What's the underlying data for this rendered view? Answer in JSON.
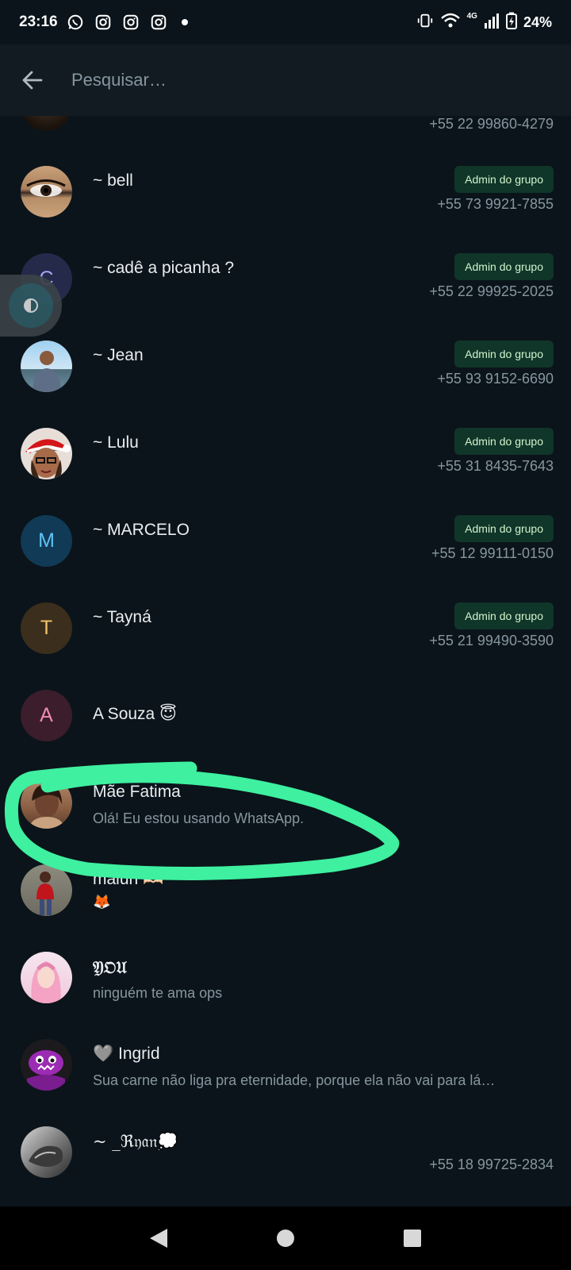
{
  "status_bar": {
    "time": "23:16",
    "network": "4G",
    "battery": "24%",
    "icons": [
      "whatsapp-icon",
      "instagram-icon",
      "instagram-icon",
      "instagram-icon",
      "notification-dot-icon",
      "vibrate-icon",
      "wifi-icon",
      "signal-icon",
      "battery-icon"
    ]
  },
  "search": {
    "placeholder": "Pesquisar…"
  },
  "colors": {
    "background": "#0b141a",
    "header": "#111b21",
    "badge_bg": "#103529",
    "badge_text": "#d1f4cc",
    "secondary_text": "#8696a0",
    "annotation": "#3ef0a0"
  },
  "participants": [
    {
      "name": "",
      "phone": "+55 22 99860-4279",
      "avatar": "photo"
    },
    {
      "name": "~ bell",
      "badge": "Admin do grupo",
      "phone": "+55 73 9921-7855",
      "avatar": "photo"
    },
    {
      "name": "~ cadê a picanha ?",
      "badge": "Admin do grupo",
      "phone": "+55 22 99925-2025",
      "avatar_letter": "C"
    },
    {
      "name": "~ Jean",
      "badge": "Admin do grupo",
      "phone": "+55 93 9152-6690",
      "avatar": "photo"
    },
    {
      "name": "~ Lulu",
      "badge": "Admin do grupo",
      "phone": "+55 31 8435-7643",
      "avatar": "photo"
    },
    {
      "name": "~ MARCELO",
      "badge": "Admin do grupo",
      "phone": "+55 12 99111-0150",
      "avatar_letter": "M"
    },
    {
      "name": "~ Tayná",
      "badge": "Admin do grupo",
      "phone": "+55 21 99490-3590",
      "avatar_letter": "T"
    },
    {
      "name": "A Souza 😇",
      "avatar_letter": "A"
    },
    {
      "name": "Mãe Fatima",
      "status": "Olá! Eu estou usando WhatsApp.",
      "avatar": "photo"
    },
    {
      "name": "maluh 🫶🏻",
      "status": "🦊",
      "avatar": "photo"
    },
    {
      "name": "𝔜𝔒𝔘",
      "status": "ninguém te ama ops",
      "avatar": "photo"
    },
    {
      "name": "🩶 Ingrid",
      "status": "Sua carne não liga pra eternidade, porque ela não vai para lá…",
      "avatar": "photo"
    },
    {
      "name": "~ _ℜ𝔶𝔞𝔫💭",
      "phone": "+55 18 99725-2834",
      "avatar": "photo"
    }
  ],
  "floating_button": {
    "icon": "contrast-icon"
  },
  "nav": {
    "icons": [
      "back-triangle-icon",
      "home-circle-icon",
      "recents-square-icon"
    ]
  }
}
